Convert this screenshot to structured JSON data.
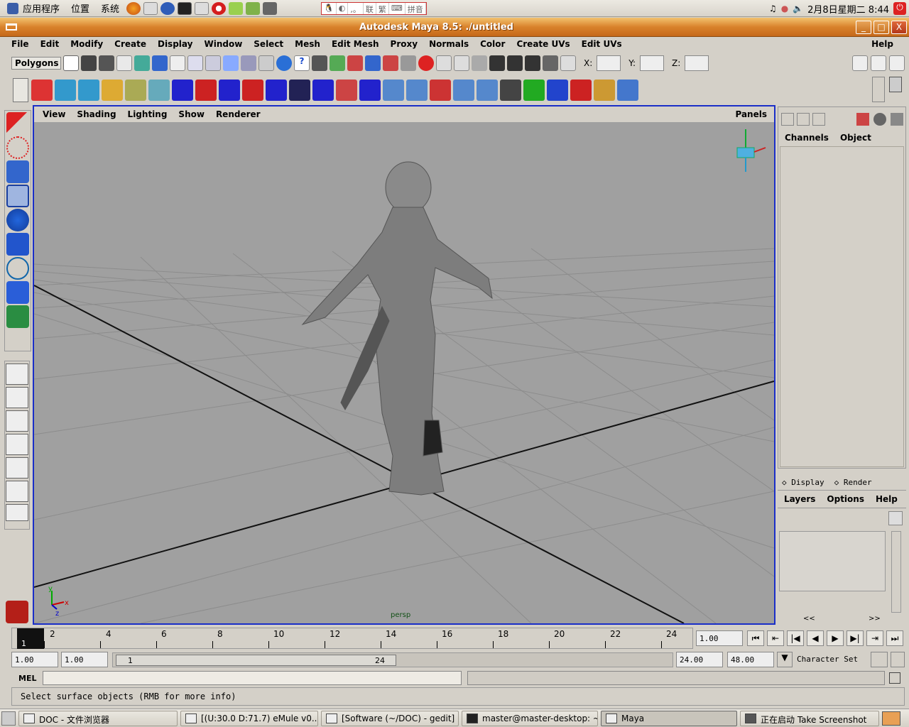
{
  "top_panel": {
    "menus": [
      "应用程序",
      "位置",
      "系统"
    ],
    "ime": [
      "联",
      "繁",
      "拼音"
    ],
    "clock": "2月8日星期二 8:44"
  },
  "window": {
    "title": "Autodesk Maya 8.5: ./untitled",
    "buttons": [
      "_",
      "□",
      "X"
    ]
  },
  "menu_bar": {
    "items": [
      "File",
      "Edit",
      "Modify",
      "Create",
      "Display",
      "Window",
      "Select",
      "Mesh",
      "Edit Mesh",
      "Proxy",
      "Normals",
      "Color",
      "Create UVs",
      "Edit UVs"
    ],
    "help": "Help"
  },
  "status_line": {
    "mode": "Polygons",
    "x_label": "X:",
    "y_label": "Y:",
    "z_label": "Z:",
    "x_value": "",
    "y_value": "",
    "z_value": ""
  },
  "viewport": {
    "menus": [
      "View",
      "Shading",
      "Lighting",
      "Show",
      "Renderer"
    ],
    "panels": "Panels",
    "camera": "persp",
    "axis_labels": {
      "x": "x",
      "y": "y",
      "z": "z"
    }
  },
  "channel_box": {
    "tabs": [
      "Channels",
      "Object"
    ]
  },
  "layer_editor": {
    "radio": [
      "Display",
      "Render"
    ],
    "menus": [
      "Layers",
      "Options",
      "Help"
    ],
    "scroll": [
      "<<",
      ">>"
    ]
  },
  "time_slider": {
    "current_frame": "1",
    "ticks": [
      "2",
      "4",
      "6",
      "8",
      "10",
      "12",
      "14",
      "16",
      "18",
      "20",
      "22",
      "24"
    ],
    "current_time": "1.00"
  },
  "range_slider": {
    "start_time": "1.00",
    "start_range": "1.00",
    "range_start_label": "1",
    "range_end_label": "24",
    "end_range": "24.00",
    "end_time": "48.00",
    "character_set": "Character Set"
  },
  "command_line": {
    "label": "MEL",
    "value": ""
  },
  "help_line": {
    "text": "Select surface objects (RMB for more info)"
  },
  "taskbar": {
    "tasks": [
      "DOC - 文件浏览器",
      "[(U:30.0 D:71.7) eMule v0...",
      "[Software (~/DOC) - gedit]",
      "master@master-desktop: ~",
      "Maya",
      "正在启动 Take Screenshot"
    ],
    "active_index": 4
  },
  "colors": {
    "title_bar": "#d9822b",
    "viewport_bg": "#a0a0a0",
    "viewport_border": "#1a2ec8",
    "panel": "#d4d0c8"
  }
}
